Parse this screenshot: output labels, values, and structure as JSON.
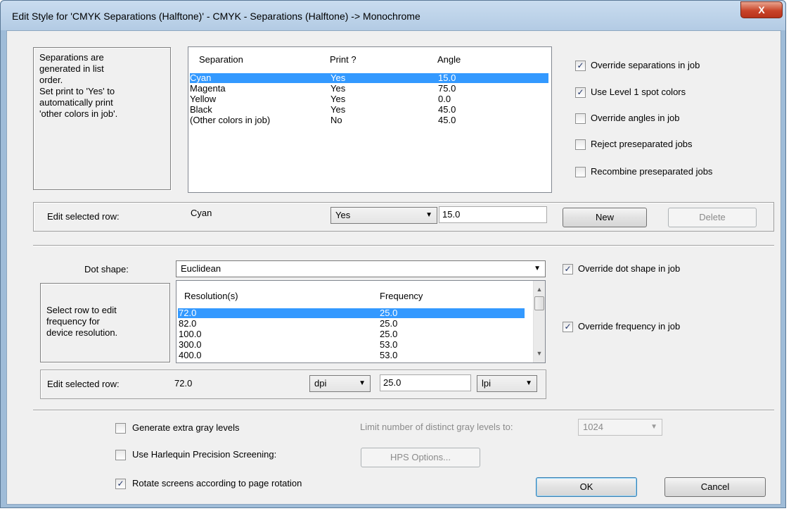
{
  "window": {
    "title": "Edit Style for 'CMYK Separations (Halftone)' - CMYK - Separations (Halftone) -> Monochrome",
    "close_glyph": "X"
  },
  "separations": {
    "note_lines": [
      "Separations are",
      "generated in list",
      "order.",
      "Set print to 'Yes' to",
      "automatically print",
      "'other colors in job'."
    ],
    "columns": [
      "Separation",
      "Print ?",
      "Angle"
    ],
    "rows": [
      {
        "separation": "Cyan",
        "print": "Yes",
        "angle": "15.0",
        "selected": true
      },
      {
        "separation": "Magenta",
        "print": "Yes",
        "angle": "75.0",
        "selected": false
      },
      {
        "separation": "Yellow",
        "print": "Yes",
        "angle": "0.0",
        "selected": false
      },
      {
        "separation": "Black",
        "print": "Yes",
        "angle": "45.0",
        "selected": false
      },
      {
        "separation": "(Other colors in job)",
        "print": "No",
        "angle": "45.0",
        "selected": false
      }
    ],
    "options": [
      {
        "label": "Override separations in job",
        "checked": true
      },
      {
        "label": "Use Level 1 spot colors",
        "checked": true
      },
      {
        "label": "Override angles in job",
        "checked": false
      },
      {
        "label": "Reject preseparated jobs",
        "checked": false
      },
      {
        "label": "Recombine preseparated jobs",
        "checked": false
      }
    ],
    "edit_row": {
      "label": "Edit selected row:",
      "name": "Cyan",
      "print_value": "Yes",
      "angle_value": "15.0",
      "new_label": "New",
      "delete_label": "Delete"
    }
  },
  "dot": {
    "label": "Dot shape:",
    "value": "Euclidean",
    "override_label": "Override dot shape in job",
    "override_checked": true
  },
  "frequency": {
    "note_lines": [
      "Select row to edit",
      "frequency for",
      "device resolution."
    ],
    "columns": [
      "Resolution(s)",
      "Frequency"
    ],
    "rows": [
      {
        "resolution": "72.0",
        "frequency": "25.0",
        "selected": true
      },
      {
        "resolution": "82.0",
        "frequency": "25.0",
        "selected": false
      },
      {
        "resolution": "100.0",
        "frequency": "25.0",
        "selected": false
      },
      {
        "resolution": "300.0",
        "frequency": "53.0",
        "selected": false
      },
      {
        "resolution": "400.0",
        "frequency": "53.0",
        "selected": false
      }
    ],
    "override_label": "Override frequency in job",
    "override_checked": true,
    "edit_row": {
      "label": "Edit selected row:",
      "resolution": "72.0",
      "res_unit": "dpi",
      "frequency": "25.0",
      "freq_unit": "lpi"
    }
  },
  "bottom": {
    "gray_label": "Generate extra gray levels",
    "gray_checked": false,
    "limit_label": "Limit number of distinct gray levels to:",
    "limit_value": "1024",
    "hps_label": "Use Harlequin Precision Screening:",
    "hps_checked": false,
    "hps_button": "HPS Options...",
    "rotate_label": "Rotate screens according to page rotation",
    "rotate_checked": true,
    "ok_label": "OK",
    "cancel_label": "Cancel"
  },
  "icons": {
    "check_glyph": "✓",
    "dropdown_glyph": "▼",
    "scroll_up_glyph": "▲",
    "scroll_down_glyph": "▼"
  }
}
